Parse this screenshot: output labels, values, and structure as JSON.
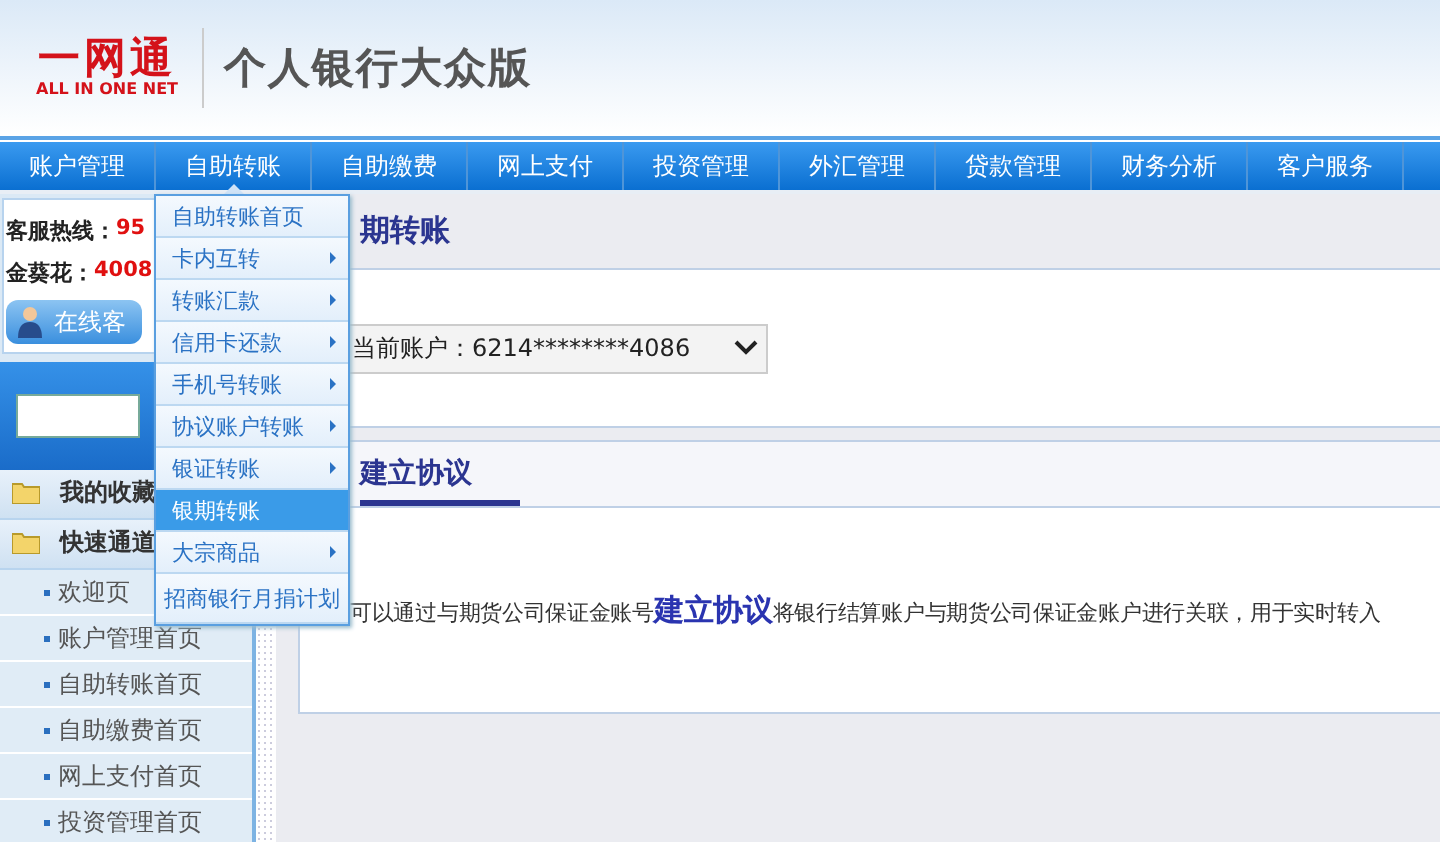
{
  "header": {
    "logo": "一网通",
    "logo_subtitle": "ALL IN ONE NET",
    "title": "个人银行大众版"
  },
  "nav": [
    {
      "label": "账户管理",
      "selected": false
    },
    {
      "label": "自助转账",
      "selected": true
    },
    {
      "label": "自助缴费",
      "selected": false
    },
    {
      "label": "网上支付",
      "selected": false
    },
    {
      "label": "投资管理",
      "selected": false
    },
    {
      "label": "外汇管理",
      "selected": false
    },
    {
      "label": "贷款管理",
      "selected": false
    },
    {
      "label": "财务分析",
      "selected": false
    },
    {
      "label": "客户服务",
      "selected": false
    }
  ],
  "sidebar": {
    "hotlines": [
      {
        "label": "客服热线：",
        "number": "95"
      },
      {
        "label": "金葵花：",
        "number": "4008"
      }
    ],
    "online_service": "在线客",
    "folders": [
      "我的收藏",
      "快速通道"
    ],
    "quick_links": [
      "欢迎页",
      "账户管理首页",
      "自助转账首页",
      "自助缴费首页",
      "网上支付首页",
      "投资管理首页"
    ]
  },
  "dropdown": [
    {
      "label": "自助转账首页",
      "submenu": false,
      "selected": false
    },
    {
      "label": "卡内互转",
      "submenu": true,
      "selected": false
    },
    {
      "label": "转账汇款",
      "submenu": true,
      "selected": false
    },
    {
      "label": "信用卡还款",
      "submenu": true,
      "selected": false
    },
    {
      "label": "手机号转账",
      "submenu": true,
      "selected": false
    },
    {
      "label": "协议账户转账",
      "submenu": true,
      "selected": false
    },
    {
      "label": "银证转账",
      "submenu": true,
      "selected": false
    },
    {
      "label": "银期转账",
      "submenu": false,
      "selected": true
    },
    {
      "label": "大宗商品",
      "submenu": true,
      "selected": false
    },
    {
      "label": "招商银行月捐计划",
      "submenu": false,
      "selected": false
    }
  ],
  "main": {
    "title": "期转账",
    "account_select": "当前账户：6214********4086",
    "tab": "建立协议",
    "description": "可以通过与期货公司保证金账号**建立协议**将银行结算账户与期货公司保证金账户进行关联，用于实时转入"
  }
}
